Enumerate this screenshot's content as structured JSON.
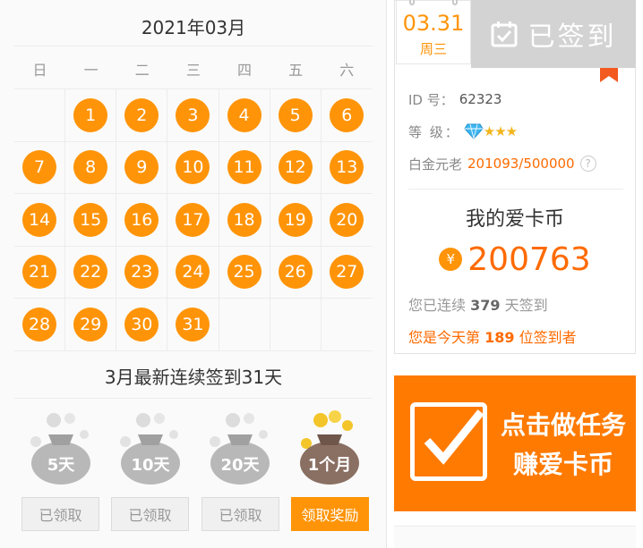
{
  "calendar": {
    "month_title": "2021年03月",
    "weekdays": [
      "日",
      "一",
      "二",
      "三",
      "四",
      "五",
      "六"
    ],
    "leading_blanks": 1,
    "days": [
      "1",
      "2",
      "3",
      "4",
      "5",
      "6",
      "7",
      "8",
      "9",
      "10",
      "11",
      "12",
      "13",
      "14",
      "15",
      "16",
      "17",
      "18",
      "19",
      "20",
      "21",
      "22",
      "23",
      "24",
      "25",
      "26",
      "27",
      "28",
      "29",
      "30",
      "31"
    ],
    "streak_title": "3月最新连续签到31天"
  },
  "rewards": [
    {
      "badge": "5天",
      "button": "已领取",
      "state": "claimed"
    },
    {
      "badge": "10天",
      "button": "已领取",
      "state": "claimed"
    },
    {
      "badge": "20天",
      "button": "已领取",
      "state": "claimed"
    },
    {
      "badge": "1个月",
      "button": "领取奖励",
      "state": "available"
    }
  ],
  "signin": {
    "date": "03.31",
    "weekday": "周三",
    "status": "已签到",
    "id_label": "ID 号：",
    "id_value": "62323",
    "level_label": "等  级：",
    "level_stars": "★★★",
    "rank_label": "白金元老",
    "rank_value": "201093/500000",
    "help": "?",
    "coin_title": "我的爱卡币",
    "coin_symbol": "¥",
    "coin_value": "200763",
    "streak_prefix": "您已连续",
    "streak_days": "379",
    "streak_suffix": "天签到",
    "today_prefix": "您是今天第",
    "today_rank": "189",
    "today_suffix": "位签到者"
  },
  "task_banner": {
    "line1": "点击做任务",
    "line2": "赚爱卡币"
  },
  "colors": {
    "accent": "#ff9408",
    "accent_text": "#ff6a00",
    "banner": "#ff7a00",
    "signed_bg": "#d3d3d3"
  }
}
